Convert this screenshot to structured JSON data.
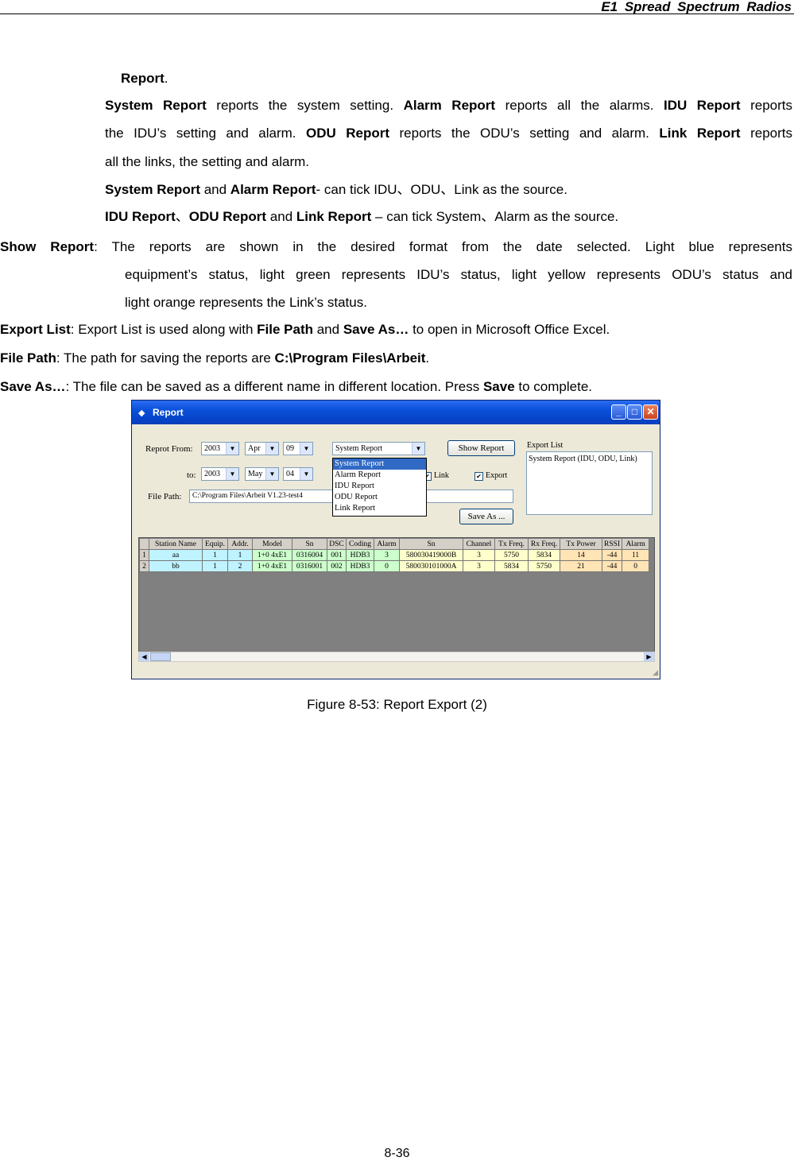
{
  "header": {
    "title": "E1  Spread  Spectrum  Radios"
  },
  "body": {
    "report_dot": {
      "b": "Report",
      "t": "."
    },
    "sysrep": {
      "l1": {
        "b1": "System Report",
        "t1": " reports the system setting. ",
        "b2": "Alarm Report",
        "t2": " reports all the alarms. ",
        "b3": "IDU Report",
        "t3": " reports"
      },
      "l2": {
        "t1": "the IDU’s setting and alarm. ",
        "b1": "ODU Report",
        "t2": " reports the ODU’s setting and alarm. ",
        "b2": "Link Report",
        "t3": " reports"
      },
      "l3": "all the links, the setting and alarm.",
      "l4": {
        "b1": "System Report",
        "t1": " and ",
        "b2": "Alarm Report",
        "t2": "- can tick IDU、ODU、Link as the source."
      },
      "l5": {
        "b1": "IDU Report",
        "t1": "、",
        "b2": "ODU Report",
        "t2": " and ",
        "b3": "Link Report",
        "t3": " – can tick System、Alarm as the source."
      }
    },
    "show_report": {
      "b": "Show  Report",
      "l1": ":  The  reports  are  shown  in  the  desired  format  from  the  date  selected.  Light  blue  represents",
      "l2": "equipment’s status, light green represents IDU’s status, light yellow represents ODU’s status and",
      "l3": "light orange represents the Link’s status."
    },
    "export_list": {
      "b1": "Export List",
      "t1": ": Export List is used along with ",
      "b2": "File Path",
      "t2": " and ",
      "b3": "Save As…",
      "t3": " to open in Microsoft Office Excel."
    },
    "file_path": {
      "b1": "File Path",
      "t1": ": The path for saving the reports are ",
      "b2": "C:\\Program Files\\Arbeit",
      "t2": "."
    },
    "save_as": {
      "b1": "Save As…",
      "t1": ": The file can be saved as a different name in different location. Press ",
      "b2": "Save",
      "t2": " to complete."
    }
  },
  "window": {
    "title": "Report",
    "report_from_label": "Reprot From:",
    "to_label": "to:",
    "from": {
      "year": "2003",
      "month": "Apr",
      "day": "09"
    },
    "to": {
      "year": "2003",
      "month": "May",
      "day": "04"
    },
    "report_type": "System Report",
    "report_options": [
      "System Report",
      "Alarm Report",
      "IDU Report",
      "ODU Report",
      "Link Report"
    ],
    "show_report_btn": "Show Report",
    "export_list_label": "Export List",
    "export_list_items": [
      "System Report (IDU, ODU, Link)"
    ],
    "link_chk": "Link",
    "export_chk": "Export",
    "file_path_label": "File Path:",
    "file_path_value": "C:\\Program Files\\Arbeit V1.23-test4",
    "save_as_btn": "Save As ...",
    "columns": [
      "",
      "Station Name",
      "Equip.",
      "Addr.",
      "Model",
      "Sn",
      "DSC",
      "Coding",
      "Alarm",
      "Sn",
      "Channel",
      "Tx Freq.",
      "Rx Freq.",
      "Tx Power",
      "RSSI",
      "Alarm"
    ],
    "rows": [
      [
        "1",
        "aa",
        "1",
        "1",
        "1+0 4xE1",
        "0316004",
        "001",
        "HDB3",
        "3",
        "580030419000B",
        "3",
        "5750",
        "5834",
        "14",
        "-44",
        "11"
      ],
      [
        "2",
        "bb",
        "1",
        "2",
        "1+0 4xE1",
        "0316001",
        "002",
        "HDB3",
        "0",
        "580030101000A",
        "3",
        "5834",
        "5750",
        "21",
        "-44",
        "0"
      ]
    ],
    "colors": {
      "equipment": "#bff3ff",
      "idu": "#ccffcc",
      "odu": "#ffffcc",
      "link": "#ffe4b5"
    }
  },
  "caption": "Figure 8-53: Report Export (2)",
  "page_number": "8-36"
}
